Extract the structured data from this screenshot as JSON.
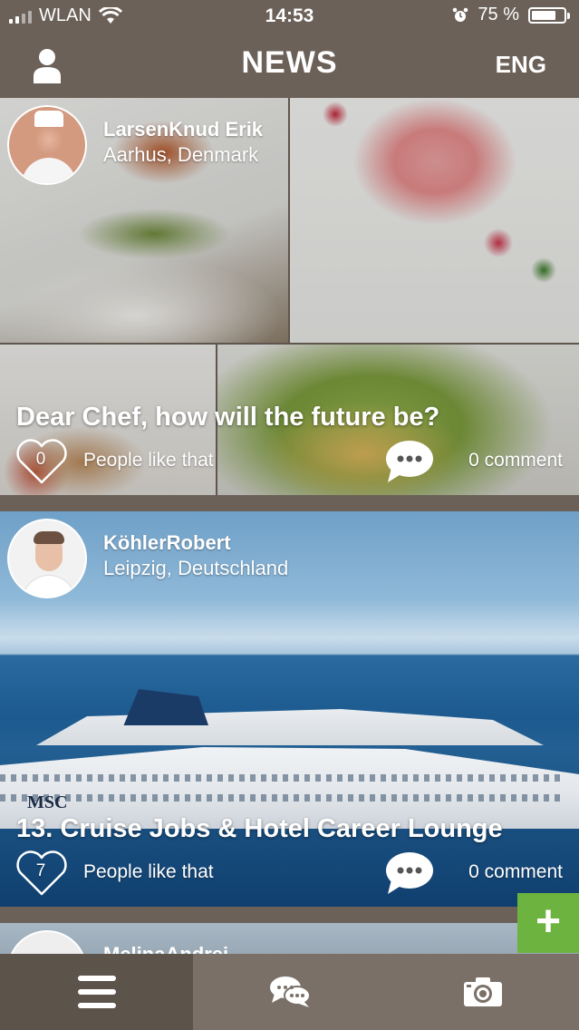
{
  "status_bar": {
    "carrier": "WLAN",
    "time": "14:53",
    "battery_percent": "75 %",
    "battery_level": 0.75
  },
  "header": {
    "title": "NEWS",
    "language": "ENG",
    "profile_icon": "user-icon"
  },
  "posts": [
    {
      "author_name": "LarsenKnud Erik",
      "author_location": "Aarhus, Denmark",
      "title": "Dear Chef, how will the future be?",
      "like_count": "0",
      "likes_label": "People like that",
      "comments_label": "0 comment"
    },
    {
      "author_name": "KöhlerRobert",
      "author_location": "Leipzig, Deutschland",
      "title": "13. Cruise Jobs & Hotel Career Lounge",
      "like_count": "7",
      "likes_label": "People like that",
      "comments_label": "0 comment"
    },
    {
      "author_name": "MelinaAndrei"
    }
  ],
  "image_text": {
    "ship_logo": "MSC"
  },
  "add_button": {
    "label": "+"
  },
  "tab_bar": {
    "items": [
      {
        "icon": "menu-icon",
        "active": true
      },
      {
        "icon": "chat-icon",
        "active": false
      },
      {
        "icon": "camera-icon",
        "active": false
      }
    ]
  },
  "colors": {
    "bar_brown": "#6b6158",
    "tab_active": "#5c534b",
    "add_green": "#6db33f"
  }
}
